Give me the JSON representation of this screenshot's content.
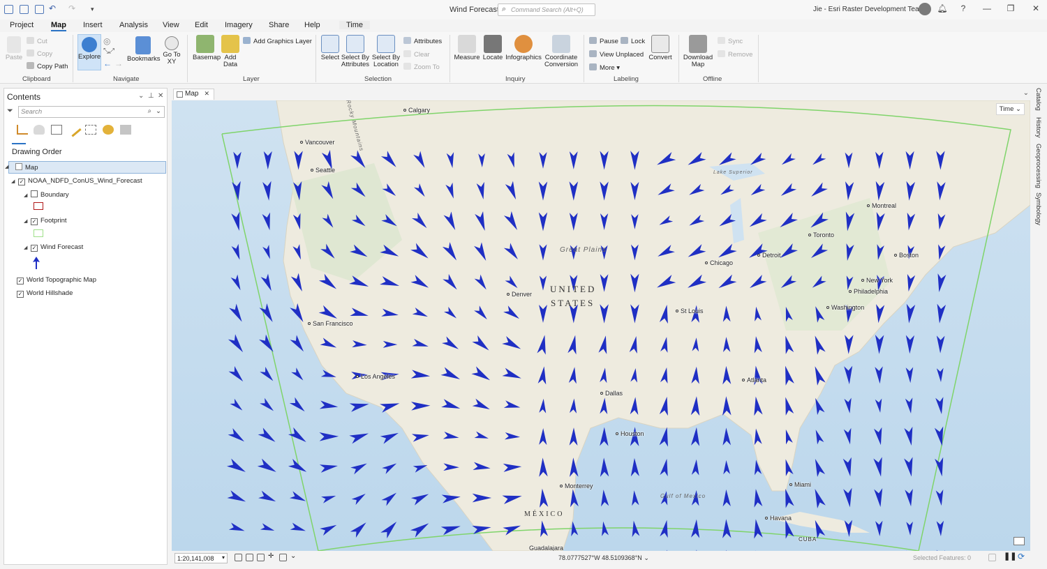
{
  "titlebar": {
    "title": "Wind Forecast",
    "command_search_placeholder": "Command Search (Alt+Q)",
    "user": "Jie - Esri Raster Development Team"
  },
  "tabs": [
    "Project",
    "Map",
    "Insert",
    "Analysis",
    "View",
    "Edit",
    "Imagery",
    "Share",
    "Help",
    "Time"
  ],
  "active_tab": "Map",
  "ribbon": {
    "clipboard": {
      "label": "Clipboard",
      "paste": "Paste",
      "cut": "Cut",
      "copy": "Copy",
      "copy_path": "Copy Path"
    },
    "navigate": {
      "label": "Navigate",
      "explore": "Explore",
      "bookmarks": "Bookmarks",
      "goto_xy": "Go To XY"
    },
    "layer": {
      "label": "Layer",
      "basemap": "Basemap",
      "add_data": "Add Data",
      "add_graphics": "Add Graphics Layer"
    },
    "selection": {
      "label": "Selection",
      "select": "Select",
      "by_attributes": "Select By Attributes",
      "by_location": "Select By Location",
      "attributes": "Attributes",
      "clear": "Clear",
      "zoom_to": "Zoom To"
    },
    "inquiry": {
      "label": "Inquiry",
      "measure": "Measure",
      "locate": "Locate",
      "infographics": "Infographics",
      "coord_conv": "Coordinate Conversion"
    },
    "labeling": {
      "label": "Labeling",
      "pause": "Pause",
      "lock": "Lock",
      "view_unplaced": "View Unplaced",
      "more": "More",
      "convert": "Convert"
    },
    "offline": {
      "label": "Offline",
      "download": "Download Map",
      "sync": "Sync",
      "remove": "Remove"
    }
  },
  "contents": {
    "title": "Contents",
    "search_placeholder": "Search",
    "drawing_order": "Drawing Order",
    "map": "Map",
    "layers": {
      "group": "NOAA_NDFD_ConUS_Wind_Forecast",
      "boundary": "Boundary",
      "footprint": "Footprint",
      "wind": "Wind Forecast",
      "topo": "World Topographic Map",
      "hillshade": "World Hillshade"
    }
  },
  "map_view": {
    "tab": "Map",
    "time_button": "Time",
    "country_us_1": "UNITED",
    "country_us_2": "STATES",
    "country_mx": "MÉXICO",
    "region_plains": "Great Plains",
    "region_rockies": "Rocky Mountains",
    "lake_superior": "Lake Superior",
    "gulf": "Gulf of Mexico",
    "cities": {
      "calgary": "Calgary",
      "vancouver": "Vancouver",
      "seattle": "Seattle",
      "montreal": "Montreal",
      "toronto": "Toronto",
      "boston": "Boston",
      "detroit": "Detroit",
      "chicago": "Chicago",
      "new_york": "New York",
      "philadelphia": "Philadelphia",
      "washington": "Washington",
      "denver": "Denver",
      "san_francisco": "San Francisco",
      "st_louis": "St Louis",
      "los_angeles": "Los Angeles",
      "atlanta": "Atlanta",
      "dallas": "Dallas",
      "houston": "Houston",
      "monterrey": "Monterrey",
      "miami": "Miami",
      "havana": "Havana",
      "cuba": "CUBA",
      "guadalajara": "Guadalajara"
    },
    "wind_color": "#1f2fc4",
    "footprint_color": "#7fd46a"
  },
  "statusbar": {
    "scale": "1:20,141,008",
    "coordinates": "78.0777527°W 48.5109368°N",
    "selected_features": "Selected Features: 0"
  },
  "side_panes": [
    "Catalog",
    "History",
    "Geoprocessing",
    "Symbology"
  ]
}
